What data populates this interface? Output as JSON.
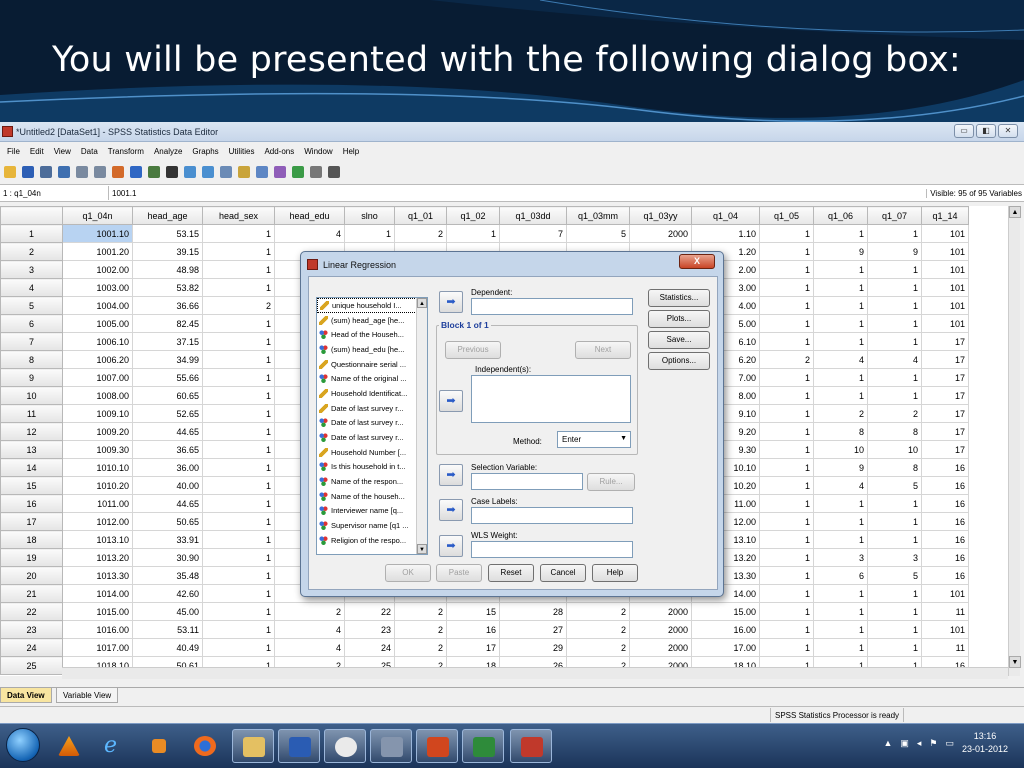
{
  "slide": {
    "title": "You will be presented with the following dialog box:"
  },
  "window": {
    "title": "*Untitled2 [DataSet1] - SPSS Statistics Data Editor",
    "buttons": [
      "▭",
      "◧",
      "✕"
    ]
  },
  "menu": [
    "File",
    "Edit",
    "View",
    "Data",
    "Transform",
    "Analyze",
    "Graphs",
    "Utilities",
    "Add-ons",
    "Window",
    "Help"
  ],
  "cellbar": {
    "ref": "1 : q1_04n",
    "value": "1001.1",
    "visible": "Visible: 95 of 95 Variables"
  },
  "grid": {
    "columns": [
      "q1_04n",
      "head_age",
      "head_sex",
      "head_edu",
      "slno",
      "q1_01",
      "q1_02",
      "q1_03dd",
      "q1_03mm",
      "q1_03yy",
      "q1_04",
      "q1_05",
      "q1_06",
      "q1_07",
      "q1_14"
    ],
    "rows": [
      [
        "1",
        "1001.10",
        "53.15",
        "1",
        "4",
        "1",
        "2",
        "1",
        "7",
        "5",
        "2000",
        "1.10",
        "1",
        "1",
        "1",
        "101"
      ],
      [
        "2",
        "1001.20",
        "39.15",
        "1",
        "",
        "",
        "",
        "",
        "",
        "",
        "",
        "1.20",
        "1",
        "9",
        "9",
        "101"
      ],
      [
        "3",
        "1002.00",
        "48.98",
        "1",
        "",
        "",
        "",
        "",
        "",
        "",
        "",
        "2.00",
        "1",
        "1",
        "1",
        "101"
      ],
      [
        "4",
        "1003.00",
        "53.82",
        "1",
        "",
        "",
        "",
        "",
        "",
        "",
        "",
        "3.00",
        "1",
        "1",
        "1",
        "101"
      ],
      [
        "5",
        "1004.00",
        "36.66",
        "2",
        "",
        "",
        "",
        "",
        "",
        "",
        "",
        "4.00",
        "1",
        "1",
        "1",
        "101"
      ],
      [
        "6",
        "1005.00",
        "82.45",
        "1",
        "",
        "",
        "",
        "",
        "",
        "",
        "",
        "5.00",
        "1",
        "1",
        "1",
        "101"
      ],
      [
        "7",
        "1006.10",
        "37.15",
        "1",
        "",
        "",
        "",
        "",
        "",
        "",
        "",
        "6.10",
        "1",
        "1",
        "1",
        "17"
      ],
      [
        "8",
        "1006.20",
        "34.99",
        "1",
        "",
        "",
        "",
        "",
        "",
        "",
        "",
        "6.20",
        "2",
        "4",
        "4",
        "17"
      ],
      [
        "9",
        "1007.00",
        "55.66",
        "1",
        "",
        "",
        "",
        "",
        "",
        "",
        "",
        "7.00",
        "1",
        "1",
        "1",
        "17"
      ],
      [
        "10",
        "1008.00",
        "60.65",
        "1",
        "",
        "",
        "",
        "",
        "",
        "",
        "",
        "8.00",
        "1",
        "1",
        "1",
        "17"
      ],
      [
        "11",
        "1009.10",
        "52.65",
        "1",
        "",
        "",
        "",
        "",
        "",
        "",
        "",
        "9.10",
        "1",
        "2",
        "2",
        "17"
      ],
      [
        "12",
        "1009.20",
        "44.65",
        "1",
        "",
        "",
        "",
        "",
        "",
        "",
        "",
        "9.20",
        "1",
        "8",
        "8",
        "17"
      ],
      [
        "13",
        "1009.30",
        "36.65",
        "1",
        "",
        "",
        "",
        "",
        "",
        "",
        "",
        "9.30",
        "1",
        "10",
        "10",
        "17"
      ],
      [
        "14",
        "1010.10",
        "36.00",
        "1",
        "",
        "",
        "",
        "",
        "",
        "",
        "",
        "10.10",
        "1",
        "9",
        "8",
        "16"
      ],
      [
        "15",
        "1010.20",
        "40.00",
        "1",
        "",
        "",
        "",
        "",
        "",
        "",
        "",
        "10.20",
        "1",
        "4",
        "5",
        "16"
      ],
      [
        "16",
        "1011.00",
        "44.65",
        "1",
        "",
        "",
        "",
        "",
        "",
        "",
        "",
        "11.00",
        "1",
        "1",
        "1",
        "16"
      ],
      [
        "17",
        "1012.00",
        "50.65",
        "1",
        "",
        "",
        "",
        "",
        "",
        "",
        "",
        "12.00",
        "1",
        "1",
        "1",
        "16"
      ],
      [
        "18",
        "1013.10",
        "33.91",
        "1",
        "",
        "",
        "",
        "",
        "",
        "",
        "",
        "13.10",
        "1",
        "1",
        "1",
        "16"
      ],
      [
        "19",
        "1013.20",
        "30.90",
        "1",
        "",
        "",
        "",
        "",
        "",
        "",
        "",
        "13.20",
        "1",
        "3",
        "3",
        "16"
      ],
      [
        "20",
        "1013.30",
        "35.48",
        "1",
        "",
        "",
        "",
        "",
        "",
        "",
        "",
        "13.30",
        "1",
        "6",
        "5",
        "16"
      ],
      [
        "21",
        "1014.00",
        "42.60",
        "1",
        "",
        "",
        "",
        "",
        "",
        "",
        "",
        "14.00",
        "1",
        "1",
        "1",
        "101"
      ],
      [
        "22",
        "1015.00",
        "45.00",
        "1",
        "2",
        "22",
        "2",
        "15",
        "28",
        "2",
        "2000",
        "15.00",
        "1",
        "1",
        "1",
        "11"
      ],
      [
        "23",
        "1016.00",
        "53.11",
        "1",
        "4",
        "23",
        "2",
        "16",
        "27",
        "2",
        "2000",
        "16.00",
        "1",
        "1",
        "1",
        "101"
      ],
      [
        "24",
        "1017.00",
        "40.49",
        "1",
        "4",
        "24",
        "2",
        "17",
        "29",
        "2",
        "2000",
        "17.00",
        "1",
        "1",
        "1",
        "11"
      ],
      [
        "25",
        "1018.10",
        "50.61",
        "1",
        "2",
        "25",
        "2",
        "18",
        "26",
        "2",
        "2000",
        "18.10",
        "1",
        "1",
        "1",
        "16"
      ]
    ]
  },
  "tabs": [
    "Data View",
    "Variable View"
  ],
  "status": "SPSS Statistics  Processor is ready",
  "dialog": {
    "title": "Linear Regression",
    "close": "X",
    "variables": [
      {
        "label": "unique household I...",
        "icon": "ruler"
      },
      {
        "label": "(sum) head_age [he...",
        "icon": "ruler"
      },
      {
        "label": "Head of the Househ...",
        "icon": "nominal"
      },
      {
        "label": "(sum) head_edu [he...",
        "icon": "nominal"
      },
      {
        "label": "Questionnaire serial ...",
        "icon": "ruler"
      },
      {
        "label": "Name of the original ...",
        "icon": "nominal"
      },
      {
        "label": "Household Identificat...",
        "icon": "ruler"
      },
      {
        "label": "Date of last survey r...",
        "icon": "ruler"
      },
      {
        "label": "Date of last survey r...",
        "icon": "nominal"
      },
      {
        "label": "Date of last survey r...",
        "icon": "nominal"
      },
      {
        "label": "Household Number [...",
        "icon": "ruler"
      },
      {
        "label": "Is this household in t...",
        "icon": "nominal"
      },
      {
        "label": "Name of the respon...",
        "icon": "nominal"
      },
      {
        "label": "Name of the househ...",
        "icon": "nominal"
      },
      {
        "label": "Interviewer name [q...",
        "icon": "nominal"
      },
      {
        "label": "Supervisor name [q1 ...",
        "icon": "nominal"
      },
      {
        "label": "Religion of the respo...",
        "icon": "nominal"
      }
    ],
    "dependent_label": "Dependent:",
    "block_label": "Block 1 of 1",
    "previous": "Previous",
    "next": "Next",
    "independent_label": "Independent(s):",
    "method_label": "Method:",
    "method_value": "Enter",
    "selection_label": "Selection Variable:",
    "rule": "Rule...",
    "case_labels": "Case Labels:",
    "wls_label": "WLS Weight:",
    "side_buttons": [
      "Statistics...",
      "Plots...",
      "Save...",
      "Options..."
    ],
    "bottom_buttons": [
      "OK",
      "Paste",
      "Reset",
      "Cancel",
      "Help"
    ]
  },
  "clock": {
    "time": "13:16",
    "date": "23-01-2012"
  },
  "colors": {
    "selected_cell": "#b8d3f2",
    "active_tab": "#f8e5a0",
    "dialog_frame": "#c5d6ea"
  }
}
